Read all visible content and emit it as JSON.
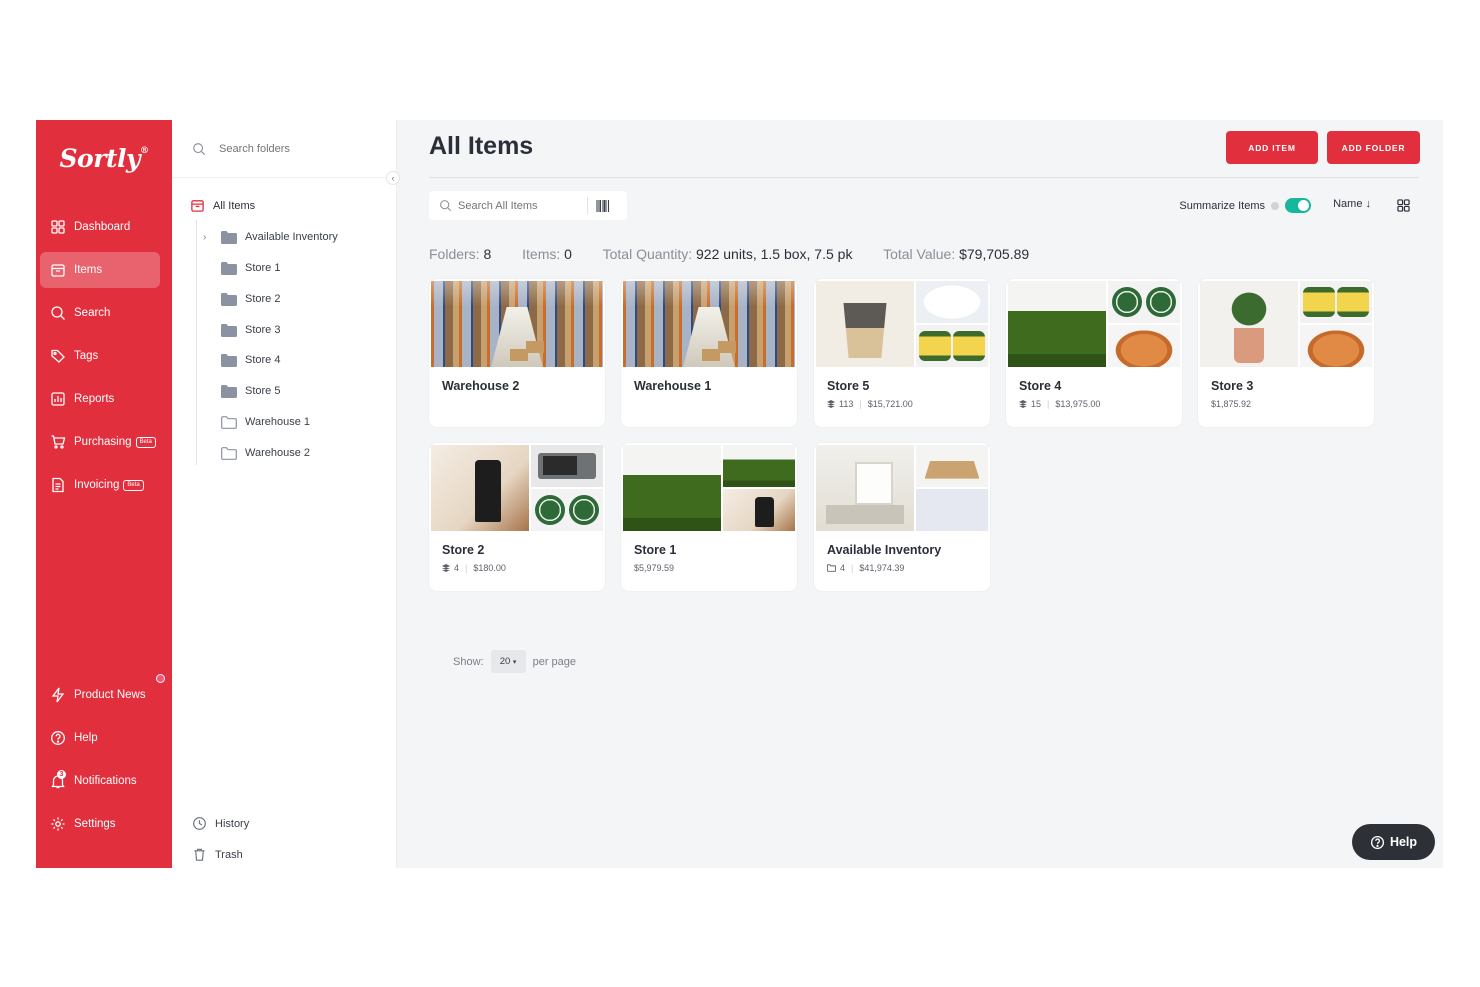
{
  "brand": {
    "logo_text": "Sortly",
    "registered": "®"
  },
  "sidebar": {
    "items": [
      {
        "label": "Dashboard",
        "icon": "dashboard-icon"
      },
      {
        "label": "Items",
        "icon": "items-icon",
        "active": true
      },
      {
        "label": "Search",
        "icon": "search-icon"
      },
      {
        "label": "Tags",
        "icon": "tag-icon"
      },
      {
        "label": "Reports",
        "icon": "reports-icon"
      },
      {
        "label": "Purchasing",
        "icon": "cart-icon",
        "badge": "Beta"
      },
      {
        "label": "Invoicing",
        "icon": "invoice-icon",
        "badge": "Beta"
      }
    ],
    "bottom": [
      {
        "label": "Product News",
        "icon": "lightning-icon"
      },
      {
        "label": "Help",
        "icon": "help-icon"
      },
      {
        "label": "Notifications",
        "icon": "bell-icon",
        "count": "3"
      },
      {
        "label": "Settings",
        "icon": "gear-icon"
      }
    ]
  },
  "folders": {
    "search_placeholder": "Search folders",
    "root": "All Items",
    "children": [
      "Available Inventory",
      "Store 1",
      "Store 2",
      "Store 3",
      "Store 4",
      "Store 5",
      "Warehouse 1",
      "Warehouse 2"
    ],
    "history_label": "History",
    "trash_label": "Trash"
  },
  "main": {
    "title": "All Items",
    "add_item_label": "ADD ITEM",
    "add_folder_label": "ADD FOLDER",
    "search_placeholder": "Search All Items",
    "summarize_label": "Summarize Items",
    "summarize_on": true,
    "sort_label": "Name",
    "stats": {
      "folders_label": "Folders:",
      "folders_value": "8",
      "items_label": "Items:",
      "items_value": "0",
      "quantity_label": "Total Quantity:",
      "quantity_value": "922 units, 1.5 box, 7.5 pk",
      "value_label": "Total Value:",
      "value_value": "$79,705.89"
    },
    "cards": [
      {
        "name": "Warehouse 2",
        "count": "",
        "value": ""
      },
      {
        "name": "Warehouse 1",
        "count": "",
        "value": ""
      },
      {
        "name": "Store 5",
        "count": "113",
        "value": "$15,721.00"
      },
      {
        "name": "Store 4",
        "count": "15",
        "value": "$13,975.00"
      },
      {
        "name": "Store 3",
        "count": "",
        "value": "$1,875.92"
      },
      {
        "name": "Store 2",
        "count": "4",
        "value": "$180.00"
      },
      {
        "name": "Store 1",
        "count": "",
        "value": "$5,979.59"
      },
      {
        "name": "Available Inventory",
        "count": "4",
        "value": "$41,974.39"
      }
    ],
    "pagination": {
      "show_label": "Show:",
      "per_page_value": "20",
      "per_page_label": "per page"
    }
  },
  "help_widget": {
    "label": "Help"
  },
  "colors": {
    "brand_red": "#e12f3d",
    "toggle_green": "#16b79a",
    "help_dark": "#2d3137"
  }
}
